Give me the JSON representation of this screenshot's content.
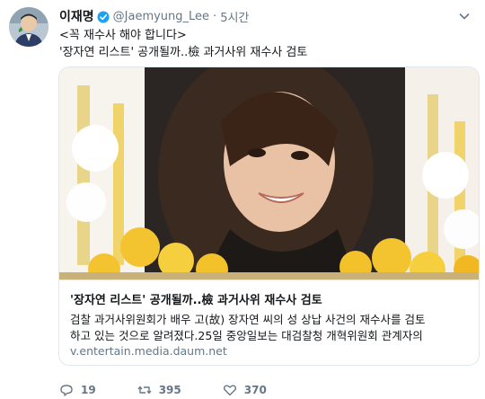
{
  "tweet": {
    "author": {
      "display_name": "이재명",
      "handle": "@Jaemyung_Lee",
      "separator": "·",
      "time": "5시간"
    },
    "text_lines": [
      "<꼭 재수사 해야 합니다>",
      "'장자연 리스트' 공개될까..檢 과거사위 재수사 검토"
    ],
    "card": {
      "title": "'장자연 리스트' 공개될까..檢 과거사위 재수사 검토",
      "description_lines": [
        "검찰 과거사위원회가 배우 고(故) 장자연 씨의 성 상납 사건의 재수사를 검토",
        "하고 있는 것으로 알려졌다.25일 중앙일보는 대검찰청 개혁위원회 관계자의"
      ],
      "domain": "v.entertain.media.daum.net"
    },
    "actions": {
      "reply_count": "19",
      "retweet_count": "395",
      "like_count": "370"
    }
  },
  "icons": [
    "verified-icon",
    "chevron-down-icon",
    "reply-icon",
    "retweet-icon",
    "like-icon"
  ],
  "colors": {
    "verified": "#1da1f2",
    "secondary_text": "#657786",
    "border": "#e1e8ed"
  }
}
